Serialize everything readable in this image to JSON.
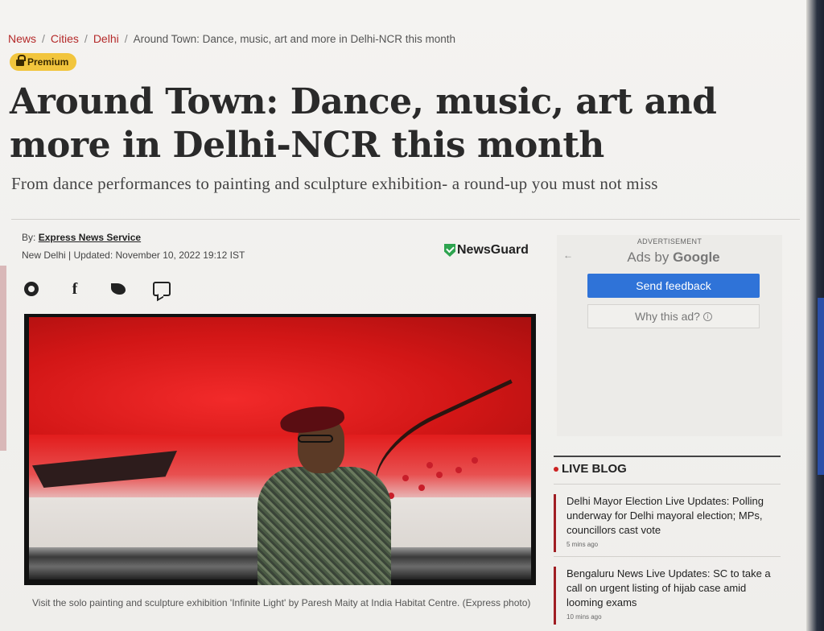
{
  "breadcrumb": {
    "items": [
      "News",
      "Cities",
      "Delhi"
    ],
    "current": "Around Town: Dance, music, art and more in Delhi-NCR this month",
    "separator": "/"
  },
  "premium_label": "Premium",
  "article": {
    "headline": "Around Town: Dance, music, art and more in Delhi-NCR this month",
    "subhead": "From dance performances to painting and sculpture exhibition- a round-up you must not miss",
    "byline_prefix": "By:",
    "author": "Express News Service",
    "dateline": "New Delhi | Updated: November 10, 2022 19:12 IST",
    "caption": "Visit the solo painting and sculpture exhibition 'Infinite Light' by Paresh Maity at India Habitat Centre. (Express photo)"
  },
  "newsguard_label": "NewsGuard",
  "share_icons": [
    "whatsapp-icon",
    "facebook-icon",
    "twitter-icon",
    "comment-icon"
  ],
  "ad": {
    "label": "ADVERTISEMENT",
    "back_arrow": "←",
    "ads_by": "Ads by",
    "google": "Google",
    "feedback_button": "Send feedback",
    "why_button": "Why this ad?"
  },
  "live_blog": {
    "title": "LIVE BLOG",
    "items": [
      {
        "text": "Delhi Mayor Election Live Updates: Polling underway for Delhi mayoral election; MPs, councillors cast vote",
        "time": "5 mins ago"
      },
      {
        "text": "Bengaluru News Live Updates: SC to take a call on urgent listing of hijab case amid looming exams",
        "time": "10 mins ago"
      }
    ]
  },
  "colors": {
    "breadcrumb_link": "#b52a2a",
    "premium_bg": "#f2c53d",
    "feedback_bg": "#2f73d8",
    "live_accent": "#a01d23"
  }
}
